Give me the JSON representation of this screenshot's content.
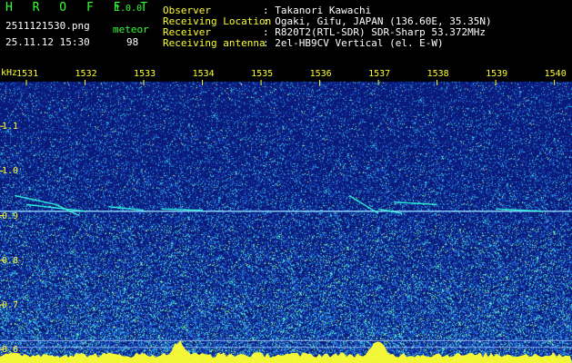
{
  "header": {
    "app_name": "H R O F F T",
    "version": "1.0.0",
    "filename": "2511121530.png",
    "datetime": "25.11.12 15:30",
    "mode_label": "meteor",
    "meteor_count": "98",
    "info_labels": [
      "Observer",
      "Receiving Location",
      "Receiver",
      "Receiving antenna"
    ],
    "info_values": [
      ": Takanori Kawachi",
      ": Ogaki, Gifu, JAPAN (136.60E, 35.35N)",
      ": R820T2(RTL-SDR) SDR-Sharp 53.372MHz",
      ": 2el-HB9CV Vertical (el. E-W)"
    ]
  },
  "chart_data": {
    "type": "heatmap",
    "ylabel": "kHz",
    "x_ticks": [
      "1531",
      "1532",
      "1533",
      "1534",
      "1535",
      "1536",
      "1537",
      "1538",
      "1539",
      "1540"
    ],
    "y_ticks": [
      "1.1",
      "1.0",
      "0.9",
      "0.8",
      "0.7",
      "0.6"
    ],
    "x_range": [
      1530.55,
      1540.3
    ],
    "y_range": [
      0.57,
      1.2
    ],
    "grid": false,
    "colors": {
      "background": "#0a1a7a",
      "noise": "#1e5ad6",
      "signal": "#33ffdd",
      "strong": "#ffff33",
      "carrier_line": "#8fd8ff"
    },
    "carrier_khz": 0.91,
    "band_lines_khz": [
      0.62,
      0.605
    ],
    "meteor_echoes": [
      {
        "x": [
          1530.8,
          1531.5
        ],
        "y": [
          0.945,
          0.925
        ]
      },
      {
        "x": [
          1531.5,
          1531.9
        ],
        "y": [
          0.925,
          0.9
        ]
      },
      {
        "x": [
          1531.0,
          1532.0
        ],
        "y": [
          0.925,
          0.91
        ]
      },
      {
        "x": [
          1532.4,
          1533.0
        ],
        "y": [
          0.92,
          0.912
        ]
      },
      {
        "x": [
          1536.5,
          1537.0
        ],
        "y": [
          0.945,
          0.905
        ]
      },
      {
        "x": [
          1537.0,
          1537.4
        ],
        "y": [
          0.915,
          0.905
        ]
      },
      {
        "x": [
          1537.3,
          1538.0
        ],
        "y": [
          0.93,
          0.925
        ]
      },
      {
        "x": [
          1539.0,
          1539.8
        ],
        "y": [
          0.915,
          0.91
        ]
      },
      {
        "x": [
          1533.3,
          1534.0
        ],
        "y": [
          0.915,
          0.912
        ]
      }
    ],
    "bottom_peaks_x": [
      1533.6,
      1537.0
    ]
  }
}
